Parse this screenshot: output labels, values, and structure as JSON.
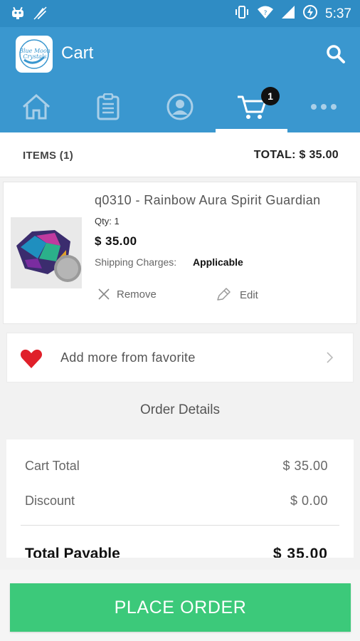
{
  "status_bar": {
    "time": "5:37",
    "icons": [
      "android-debug-icon",
      "no-sound-icon",
      "vibrate-icon",
      "wifi-icon",
      "signal-icon",
      "battery-charging-icon"
    ]
  },
  "app_bar": {
    "title": "Cart",
    "logo_text": "Blue Moon Crystals"
  },
  "tabs": [
    {
      "name": "home",
      "icon": "home-icon"
    },
    {
      "name": "orders",
      "icon": "clipboard-icon"
    },
    {
      "name": "account",
      "icon": "account-icon"
    },
    {
      "name": "cart",
      "icon": "cart-icon",
      "badge": "1",
      "active": true
    },
    {
      "name": "more",
      "icon": "more-icon"
    }
  ],
  "summary": {
    "items_label": "ITEMS (1)",
    "total_label": "TOTAL: $  35.00"
  },
  "cart_items": [
    {
      "name": "q0310 - Rainbow Aura Spirit Guardian",
      "qty": "Qty: 1",
      "price": "$  35.00",
      "shipping_label": "Shipping Charges:",
      "shipping_value": "Applicable",
      "remove_label": "Remove",
      "edit_label": "Edit"
    }
  ],
  "favorites": {
    "label": "Add more from favorite"
  },
  "order_details": {
    "heading": "Order Details",
    "rows": [
      {
        "label": "Cart Total",
        "value": "$  35.00"
      },
      {
        "label": "Discount",
        "value": "$  0.00"
      }
    ],
    "total_label": "Total Payable",
    "total_value": "$  35.00"
  },
  "actions": {
    "place_order": "PLACE ORDER"
  },
  "colors": {
    "primary": "#3a97cf",
    "status_bar": "#2f8cc4",
    "tab_icon": "#a9cfe8",
    "button": "#3cc97a",
    "heart": "#e0202a"
  }
}
